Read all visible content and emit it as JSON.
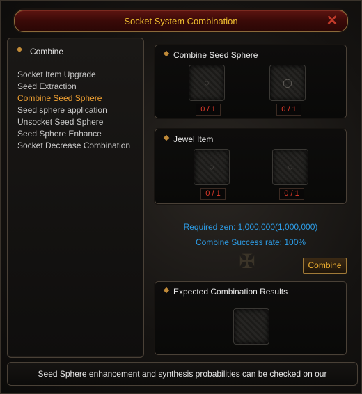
{
  "window": {
    "title": "Socket System Combination",
    "close_symbol": "✕"
  },
  "left_panel": {
    "header": "Combine",
    "menu_items": [
      {
        "label": "Socket Item Upgrade"
      },
      {
        "label": "Seed Extraction"
      },
      {
        "label": "Combine Seed Sphere"
      },
      {
        "label": "Seed sphere application"
      },
      {
        "label": "Unsocket Seed Sphere"
      },
      {
        "label": "Seed Sphere Enhance"
      },
      {
        "label": "Socket Decrease Combination"
      }
    ],
    "active_item": "Combine Seed Sphere"
  },
  "seed_sphere_panel": {
    "title": "Combine Seed Sphere",
    "slots": [
      {
        "icon": "seed-icon",
        "count": "0 / 1"
      },
      {
        "icon": "sphere-icon",
        "count": "0 / 1"
      }
    ]
  },
  "jewel_panel": {
    "title": "Jewel Item",
    "slots": [
      {
        "icon": "jewel-icon",
        "count": "0 / 1"
      },
      {
        "icon": "jewel-icon",
        "count": "0 / 1"
      }
    ]
  },
  "info": {
    "required_zen": "Required zen: 1,000,000(1,000,000)",
    "success_rate": "Combine Success rate: 100%"
  },
  "combine_button": "Combine",
  "results_panel": {
    "title": "Expected Combination Results"
  },
  "footer": {
    "text": "Seed Sphere enhancement and synthesis probabilities can be checked on our"
  },
  "colors": {
    "title_gold": "#f0c030",
    "active_orange": "#f2a232",
    "info_blue": "#2d9ee8",
    "count_red": "#e03a2a"
  }
}
